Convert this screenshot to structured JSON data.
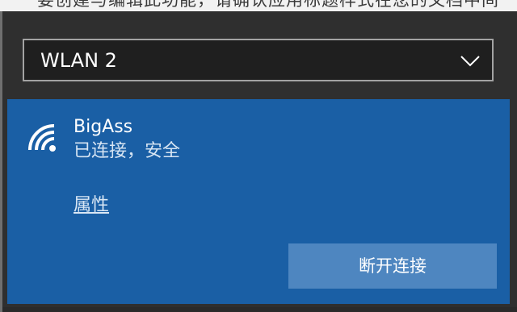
{
  "background_document": {
    "partial_text": "要创建与编辑此功能，请确认应用标题样式在您的文档中间"
  },
  "adapter": {
    "selected": "WLAN 2",
    "dropdown_icon": "chevron-down-icon"
  },
  "network": {
    "ssid": "BigAss",
    "status": "已连接，安全",
    "properties_label": "属性",
    "signal_icon": "wifi-signal-icon",
    "disconnect_label": "断开连接"
  },
  "colors": {
    "panel_accent": "#1a5fa5",
    "button": "#4e86c0",
    "flyout_bg": "#2f2f2f"
  }
}
